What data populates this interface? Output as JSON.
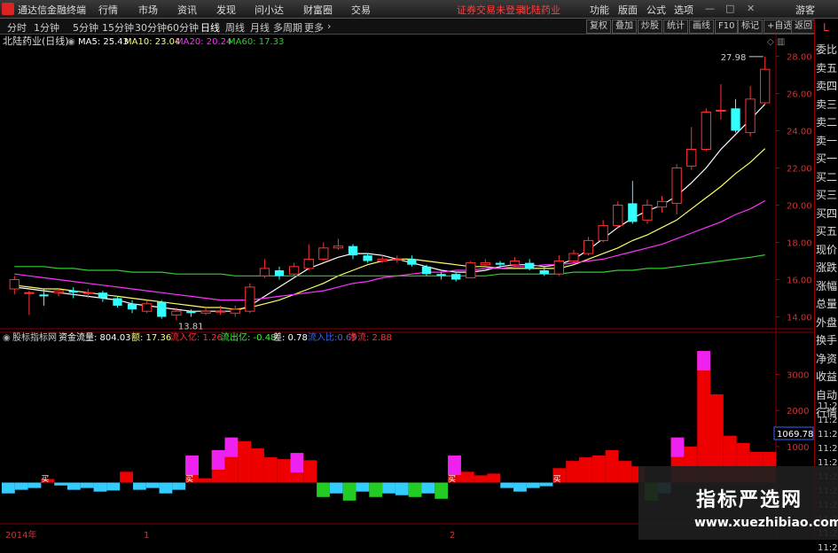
{
  "menubar": {
    "app_title": "通达信金融终端",
    "items": [
      "行情",
      "市场",
      "资讯",
      "发现",
      "问小达",
      "财富圈",
      "交易"
    ],
    "status": "证券交易未登录",
    "stock": "北陆药业",
    "right_items": [
      "功能",
      "版面",
      "公式",
      "选项"
    ],
    "guest": "游客"
  },
  "periodbar": {
    "items": [
      "分时",
      "1分钟",
      "5分钟",
      "15分钟",
      "30分钟",
      "60分钟",
      "日线",
      "周线",
      "月线",
      "多周期",
      "更多"
    ],
    "active": "日线",
    "tools": [
      "复权",
      "叠加",
      "炒股",
      "统计",
      "画线",
      "F10",
      "标记",
      "+自选",
      "返回"
    ]
  },
  "main_chart": {
    "title": "北陆药业(日线)",
    "ma5_label": "MA5: 25.43",
    "ma10_label": "MA10: 23.04",
    "ma20_label": "MA20: 20.24",
    "ma60_label": "MA60: 17.33",
    "high_label": "27.98",
    "low_label": "13.81",
    "colors": {
      "ma5": "#ffffff",
      "ma10": "#ffff66",
      "ma20": "#ff33ff",
      "ma60": "#33cc33",
      "up": "#ff3333",
      "down": "#33ffff"
    }
  },
  "chart_data": [
    {
      "type": "candlestick",
      "y_axis_ticks": [
        "28.00",
        "26.00",
        "24.00",
        "22.00",
        "20.00",
        "18.00",
        "16.00",
        "14.00"
      ],
      "ylim": [
        13.5,
        28.5
      ],
      "candles": [
        {
          "o": 15.5,
          "c": 16.0,
          "h": 16.2,
          "l": 15.2
        },
        {
          "o": 15.3,
          "c": 15.3,
          "h": 15.4,
          "l": 14.1
        },
        {
          "o": 15.2,
          "c": 15.1,
          "h": 15.5,
          "l": 14.6
        },
        {
          "o": 15.3,
          "c": 15.4,
          "h": 15.5,
          "l": 15.1
        },
        {
          "o": 15.4,
          "c": 15.3,
          "h": 15.6,
          "l": 15.0
        },
        {
          "o": 15.3,
          "c": 15.3,
          "h": 15.5,
          "l": 15.0
        },
        {
          "o": 15.3,
          "c": 15.0,
          "h": 15.4,
          "l": 14.8
        },
        {
          "o": 15.0,
          "c": 14.6,
          "h": 15.1,
          "l": 14.5
        },
        {
          "o": 14.7,
          "c": 14.4,
          "h": 14.9,
          "l": 14.2
        },
        {
          "o": 14.3,
          "c": 14.7,
          "h": 14.9,
          "l": 14.2
        },
        {
          "o": 14.8,
          "c": 14.0,
          "h": 14.9,
          "l": 13.9
        },
        {
          "o": 14.1,
          "c": 14.3,
          "h": 14.5,
          "l": 13.81
        },
        {
          "o": 14.3,
          "c": 14.2,
          "h": 14.4,
          "l": 14.0
        },
        {
          "o": 14.2,
          "c": 14.3,
          "h": 14.5,
          "l": 14.1
        },
        {
          "o": 14.3,
          "c": 14.3,
          "h": 14.6,
          "l": 14.1
        },
        {
          "o": 14.2,
          "c": 14.4,
          "h": 14.6,
          "l": 14.0
        },
        {
          "o": 14.3,
          "c": 15.6,
          "h": 15.8,
          "l": 14.2
        },
        {
          "o": 16.2,
          "c": 16.6,
          "h": 17.1,
          "l": 16.1
        },
        {
          "o": 16.5,
          "c": 16.2,
          "h": 16.7,
          "l": 16.0
        },
        {
          "o": 16.3,
          "c": 16.7,
          "h": 16.9,
          "l": 16.2
        },
        {
          "o": 16.6,
          "c": 17.1,
          "h": 17.9,
          "l": 16.5
        },
        {
          "o": 17.1,
          "c": 17.7,
          "h": 18.0,
          "l": 17.0
        },
        {
          "o": 17.7,
          "c": 17.8,
          "h": 18.2,
          "l": 17.6
        },
        {
          "o": 17.8,
          "c": 17.3,
          "h": 17.9,
          "l": 17.1
        },
        {
          "o": 17.3,
          "c": 17.0,
          "h": 17.4,
          "l": 16.9
        },
        {
          "o": 17.0,
          "c": 17.1,
          "h": 17.3,
          "l": 16.9
        },
        {
          "o": 17.1,
          "c": 17.1,
          "h": 17.3,
          "l": 16.9
        },
        {
          "o": 17.1,
          "c": 16.8,
          "h": 17.3,
          "l": 16.7
        },
        {
          "o": 16.7,
          "c": 16.3,
          "h": 16.8,
          "l": 16.2
        },
        {
          "o": 16.3,
          "c": 16.2,
          "h": 16.4,
          "l": 16.0
        },
        {
          "o": 16.3,
          "c": 16.0,
          "h": 16.4,
          "l": 15.9
        },
        {
          "o": 16.1,
          "c": 16.9,
          "h": 17.0,
          "l": 16.1
        },
        {
          "o": 16.8,
          "c": 16.9,
          "h": 17.1,
          "l": 16.7
        },
        {
          "o": 16.9,
          "c": 16.8,
          "h": 17.0,
          "l": 16.6
        },
        {
          "o": 16.8,
          "c": 17.0,
          "h": 17.2,
          "l": 16.7
        },
        {
          "o": 16.9,
          "c": 16.6,
          "h": 17.1,
          "l": 16.5
        },
        {
          "o": 16.5,
          "c": 16.3,
          "h": 16.7,
          "l": 16.2
        },
        {
          "o": 16.3,
          "c": 17.0,
          "h": 17.3,
          "l": 16.2
        },
        {
          "o": 17.0,
          "c": 17.4,
          "h": 17.6,
          "l": 16.9
        },
        {
          "o": 17.4,
          "c": 18.1,
          "h": 18.3,
          "l": 17.3
        },
        {
          "o": 18.1,
          "c": 18.9,
          "h": 19.2,
          "l": 18.0
        },
        {
          "o": 18.9,
          "c": 20.0,
          "h": 20.2,
          "l": 18.8
        },
        {
          "o": 20.1,
          "c": 19.1,
          "h": 21.3,
          "l": 19.0
        },
        {
          "o": 19.2,
          "c": 20.0,
          "h": 20.3,
          "l": 19.0
        },
        {
          "o": 19.9,
          "c": 20.2,
          "h": 20.5,
          "l": 19.6
        },
        {
          "o": 20.1,
          "c": 22.0,
          "h": 22.2,
          "l": 19.5
        },
        {
          "o": 22.1,
          "c": 23.0,
          "h": 24.2,
          "l": 21.9
        },
        {
          "o": 23.0,
          "c": 25.0,
          "h": 25.2,
          "l": 22.9
        },
        {
          "o": 25.1,
          "c": 25.1,
          "h": 26.5,
          "l": 24.6
        },
        {
          "o": 25.2,
          "c": 24.0,
          "h": 25.7,
          "l": 23.9
        },
        {
          "o": 23.9,
          "c": 25.7,
          "h": 26.4,
          "l": 23.7
        },
        {
          "o": 25.5,
          "c": 27.3,
          "h": 27.98,
          "l": 25.4
        }
      ],
      "ma_series": [
        {
          "name": "MA5",
          "points": [
            15.6,
            15.5,
            15.4,
            15.3,
            15.2,
            15.1,
            15.0,
            14.9,
            14.7,
            14.6,
            14.5,
            14.4,
            14.3,
            14.3,
            14.3,
            14.3,
            14.6,
            15.1,
            15.6,
            16.1,
            16.6,
            16.9,
            17.2,
            17.4,
            17.4,
            17.3,
            17.1,
            16.9,
            16.7,
            16.5,
            16.4,
            16.4,
            16.5,
            16.7,
            16.8,
            16.8,
            16.7,
            16.8,
            17.1,
            17.6,
            18.2,
            18.8,
            19.3,
            19.7,
            20.0,
            20.5,
            21.2,
            22.0,
            23.0,
            23.8,
            24.6,
            25.43
          ]
        },
        {
          "name": "MA10",
          "points": [
            15.7,
            15.6,
            15.5,
            15.5,
            15.4,
            15.3,
            15.2,
            15.1,
            15.0,
            14.9,
            14.8,
            14.7,
            14.6,
            14.5,
            14.5,
            14.4,
            14.5,
            14.7,
            14.9,
            15.2,
            15.5,
            15.8,
            16.2,
            16.5,
            16.8,
            17.0,
            17.1,
            17.1,
            17.0,
            16.9,
            16.8,
            16.7,
            16.7,
            16.6,
            16.6,
            16.6,
            16.6,
            16.6,
            16.8,
            17.1,
            17.4,
            17.7,
            18.1,
            18.4,
            18.8,
            19.2,
            19.8,
            20.4,
            21.0,
            21.7,
            22.3,
            23.04
          ]
        },
        {
          "name": "MA20",
          "points": [
            16.3,
            16.2,
            16.1,
            16.0,
            15.9,
            15.8,
            15.7,
            15.6,
            15.5,
            15.4,
            15.3,
            15.2,
            15.1,
            15.0,
            14.9,
            14.9,
            14.9,
            15.0,
            15.1,
            15.2,
            15.3,
            15.4,
            15.6,
            15.8,
            15.9,
            16.1,
            16.2,
            16.3,
            16.4,
            16.4,
            16.5,
            16.5,
            16.6,
            16.6,
            16.7,
            16.7,
            16.8,
            16.8,
            16.9,
            17.0,
            17.1,
            17.3,
            17.5,
            17.7,
            17.9,
            18.2,
            18.5,
            18.8,
            19.1,
            19.5,
            19.8,
            20.24
          ]
        },
        {
          "name": "MA60",
          "points": [
            16.7,
            16.7,
            16.7,
            16.6,
            16.6,
            16.5,
            16.5,
            16.5,
            16.4,
            16.4,
            16.4,
            16.3,
            16.3,
            16.3,
            16.3,
            16.2,
            16.2,
            16.2,
            16.2,
            16.2,
            16.2,
            16.2,
            16.2,
            16.2,
            16.2,
            16.2,
            16.2,
            16.2,
            16.2,
            16.2,
            16.2,
            16.2,
            16.2,
            16.3,
            16.3,
            16.3,
            16.3,
            16.3,
            16.4,
            16.4,
            16.4,
            16.5,
            16.5,
            16.6,
            16.6,
            16.7,
            16.8,
            16.9,
            17.0,
            17.1,
            17.2,
            17.33
          ]
        }
      ]
    },
    {
      "type": "bar",
      "y_axis_ticks": [
        "3000",
        "2000",
        "1000"
      ],
      "ylim": [
        -700,
        3800
      ],
      "values": [
        -300,
        -200,
        -150,
        100,
        -80,
        -200,
        -150,
        -250,
        -220,
        300,
        -200,
        -150,
        -300,
        -200,
        750,
        120,
        900,
        1250,
        1150,
        950,
        700,
        650,
        820,
        620,
        -400,
        -300,
        -500,
        -250,
        -400,
        -300,
        -350,
        -400,
        -300,
        -450,
        750,
        300,
        200,
        250,
        -150,
        -250,
        -150,
        -100,
        400,
        600,
        700,
        750,
        900,
        600,
        450,
        -500,
        -300,
        1250,
        1000,
        3650,
        2450,
        1300,
        1100,
        850,
        850
      ]
    }
  ],
  "indicator": {
    "title": "股标指标网",
    "flow_label": "资金流量: 804.03",
    "v2_label": "额: 17.36",
    "inflow_label": "流入亿: 1.26",
    "outflow_label": "流出亿: -0.48",
    "diff_label": "差: 0.78",
    "extra1": "流入比:0.65",
    "net_label": "净流: 2.88",
    "buy_marker": "买",
    "current_value": "1069.78"
  },
  "xaxis": {
    "labels": [
      "2014年",
      "1",
      "2"
    ]
  },
  "right_panel": {
    "labels": [
      "委比",
      "卖五",
      "卖四",
      "卖三",
      "卖二",
      "卖一",
      "买一",
      "买二",
      "买三",
      "买四",
      "买五",
      "现价",
      "涨跌",
      "涨幅",
      "总量",
      "外盘",
      "换手",
      "净资",
      "收益",
      "自动",
      "行情"
    ],
    "times": [
      "11:29",
      "11:28",
      "11:28",
      "11:28",
      "11:28",
      "11:29",
      "11:29",
      "11:29",
      "11:29",
      "11:29",
      "11:29"
    ],
    "top_mark": "L"
  },
  "watermark": {
    "line1": "指标严选网",
    "line2": "www.xuezhibiao.com"
  }
}
